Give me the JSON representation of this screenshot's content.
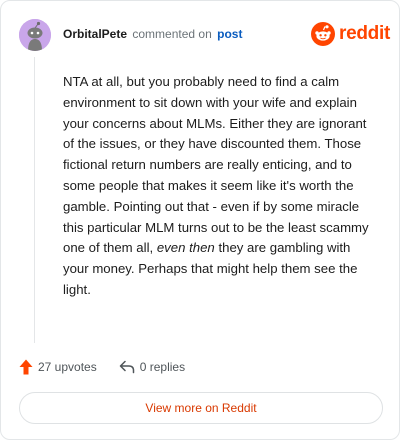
{
  "comment": {
    "username": "OrbitalPete",
    "action_text": "commented on",
    "post_link": "post",
    "body_parts": [
      "NTA at all, but you probably need to find a calm environment to sit down with your wife and explain your concerns about MLMs. Either they are ignorant of the issues, or they have discounted them. Those fictional return numbers are really enticing, and to some people that makes it seem like it's worth the gamble. Pointing out that - even if by some miracle this particular MLM turns out to be the least scammy one of them all, ",
      "even then",
      " they are gambling with your money. Perhaps that might help them see the light."
    ]
  },
  "brand": {
    "name": "reddit",
    "icon": "reddit-snoo-icon",
    "color": "#ff4500"
  },
  "stats": {
    "upvotes": "27 upvotes",
    "replies": "0 replies"
  },
  "footer": {
    "view_more": "View more on Reddit"
  },
  "colors": {
    "accent": "#ff4500",
    "link": "#0a5cbf",
    "avatar_bg": "#c9a6ea"
  },
  "icons": {
    "avatar": "snoo-avatar",
    "upvote": "upvote-arrow-icon",
    "reply": "reply-arrow-icon"
  }
}
